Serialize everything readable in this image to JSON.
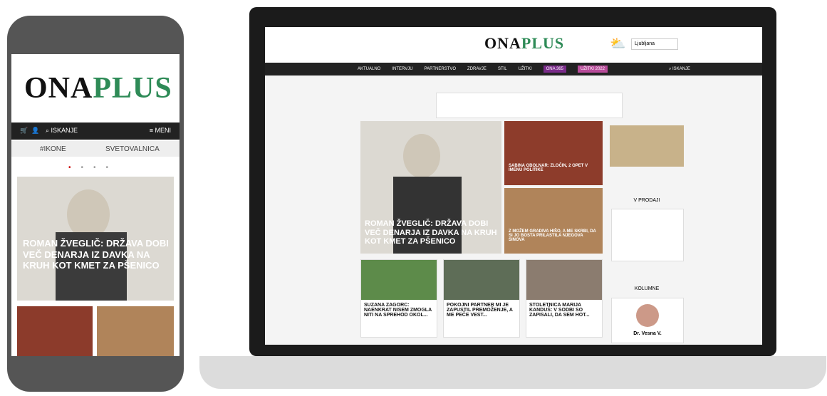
{
  "phone": {
    "logo": "ONA",
    "logo_plus": "PLUS",
    "search": "ISKANJE",
    "menu": "MENI",
    "tabs": [
      "#IKONE",
      "SVETOVALNICA"
    ],
    "hero_title": "ROMAN ŽVEGLIČ: DRŽAVA DOBI VEČ DENARJA IZ DAVKA NA KRUH KOT KMET ZA PŠENICO"
  },
  "laptop": {
    "logo": "ONA",
    "logo_plus": "PLUS",
    "location": "Ljubljana",
    "nav": [
      "AKTUALNO",
      "INTERVJU",
      "PARTNERSTVO",
      "ZDRAVJE",
      "STIL",
      "UŽITKI",
      "ONA 365",
      "UŽITKI 2022"
    ],
    "search": "ISKANJE",
    "hero": "ROMAN ŽVEGLIČ: DRŽAVA DOBI VEČ DENARJA IZ DAVKA NA KRUH KOT KMET ZA PŠENICO",
    "side_a": "SABINA OBOLNAR: ZLOČIN, 2 OPET V IMENU POLITIKE",
    "side_b": "Z MOŽEM GRADIVA HIŠO, A ME SKRBI, DA SI JO BOSTA PRILASTILA NJEGOVA SINOVA",
    "v_prodaji": "V PRODAJI",
    "kolumne": "KOLUMNE",
    "card_titles": [
      "SUZANA ZAGORC: NAENKRAT NISEM ZMOGLA NITI NA SPREHOD OKOL...",
      "POKOJNI PARTNER MI JE ZAPUSTIL PREMOŽENJE, A ME PEČE VEST...",
      "STOLETNICA MARIJA KANDUŠ: V SODBI SO ZAPISALI, DA SEM HOT..."
    ],
    "columnist": "Dr. Vesna V."
  }
}
